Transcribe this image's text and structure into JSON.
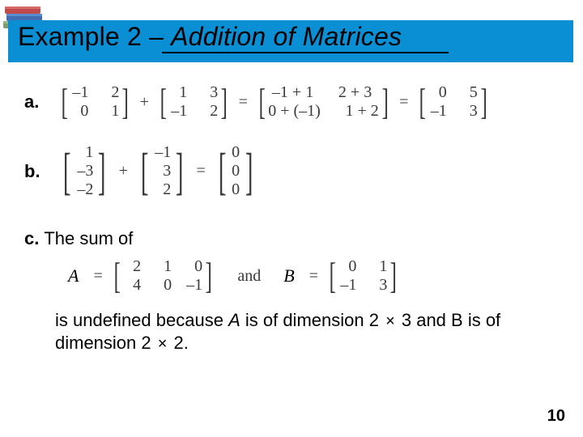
{
  "title": {
    "prefix": "Example 2 – ",
    "topic": "Addition of Matrices"
  },
  "parts": {
    "a": {
      "label": "a.",
      "m1": [
        [
          "–1",
          "2"
        ],
        [
          "0",
          "1"
        ]
      ],
      "plus": "+",
      "m2": [
        [
          "1",
          "3"
        ],
        [
          "–1",
          "2"
        ]
      ],
      "eq": "=",
      "m3": [
        [
          "–1 + 1",
          "2 + 3"
        ],
        [
          "0 + (–1)",
          "1 + 2"
        ]
      ],
      "m4": [
        [
          "0",
          "5"
        ],
        [
          "–1",
          "3"
        ]
      ]
    },
    "b": {
      "label": "b.",
      "m1": [
        [
          "1"
        ],
        [
          "–3"
        ],
        [
          "–2"
        ]
      ],
      "plus": "+",
      "m2": [
        [
          "–1"
        ],
        [
          "3"
        ],
        [
          "2"
        ]
      ],
      "eq": "=",
      "m3": [
        [
          "0"
        ],
        [
          "0"
        ],
        [
          "0"
        ]
      ]
    },
    "c": {
      "label": "c.",
      "head": "The sum of",
      "Aname": "A",
      "eq": "=",
      "A": [
        [
          "2",
          "1",
          "0"
        ],
        [
          "4",
          "0",
          "–1"
        ]
      ],
      "and": "and",
      "Bname": "B",
      "B": [
        [
          "0",
          "1"
        ],
        [
          "–1",
          "3"
        ]
      ],
      "explain_pre": "is undefined because ",
      "explain_A": "A",
      "explain_mid1": " is of dimension 2 ",
      "times": "×",
      "explain_mid2": " 3 and B is of",
      "explain_line2_pre": "dimension 2 ",
      "explain_line2_post": " 2."
    }
  },
  "pagenum": "10",
  "icon": "books-icon"
}
